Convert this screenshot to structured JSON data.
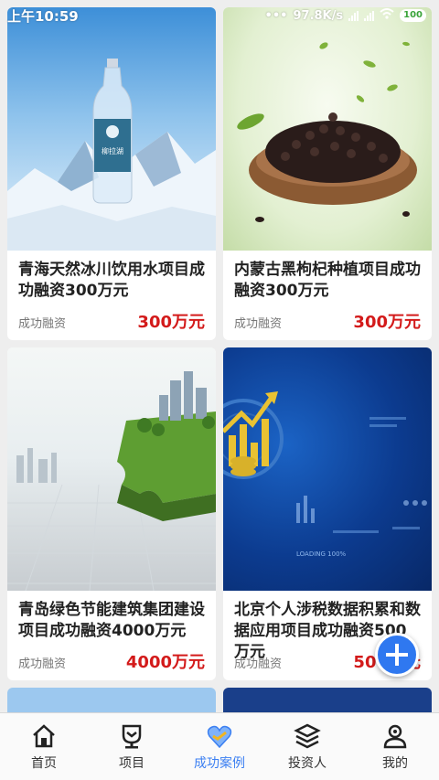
{
  "status_bar": {
    "time": "上午10:59",
    "speed": "97.8K/s",
    "battery": "100"
  },
  "cards": [
    {
      "title": "青海天然冰川饮用水项目成功融资300万元",
      "tag": "成功融资",
      "amount": "300万元",
      "image": "water-bottle-mountains",
      "bottle_label": "柳拉湖"
    },
    {
      "title": "内蒙古黑枸杞种植项目成功融资300万元",
      "tag": "成功融资",
      "amount": "300万元",
      "image": "black-goji-bowl"
    },
    {
      "title": "青岛绿色节能建筑集团建设项目成功融资4000万元",
      "tag": "成功融资",
      "amount": "4000万元",
      "image": "green-puzzle-city"
    },
    {
      "title": "北京个人涉税数据积累和数据应用项目成功融资500万元",
      "tag": "成功融资",
      "amount": "500万元",
      "image": "blue-data-chart",
      "image_text": "LOADING 100%"
    }
  ],
  "tabbar": {
    "items": [
      {
        "label": "首页",
        "icon": "home-icon"
      },
      {
        "label": "项目",
        "icon": "project-icon"
      },
      {
        "label": "成功案例",
        "icon": "success-case-icon",
        "active": true
      },
      {
        "label": "投资人",
        "icon": "investor-icon"
      },
      {
        "label": "我的",
        "icon": "profile-icon"
      }
    ]
  },
  "colors": {
    "accent": "#3b7ff2",
    "amount": "#d31a1a",
    "fab": "#2f78f0"
  }
}
